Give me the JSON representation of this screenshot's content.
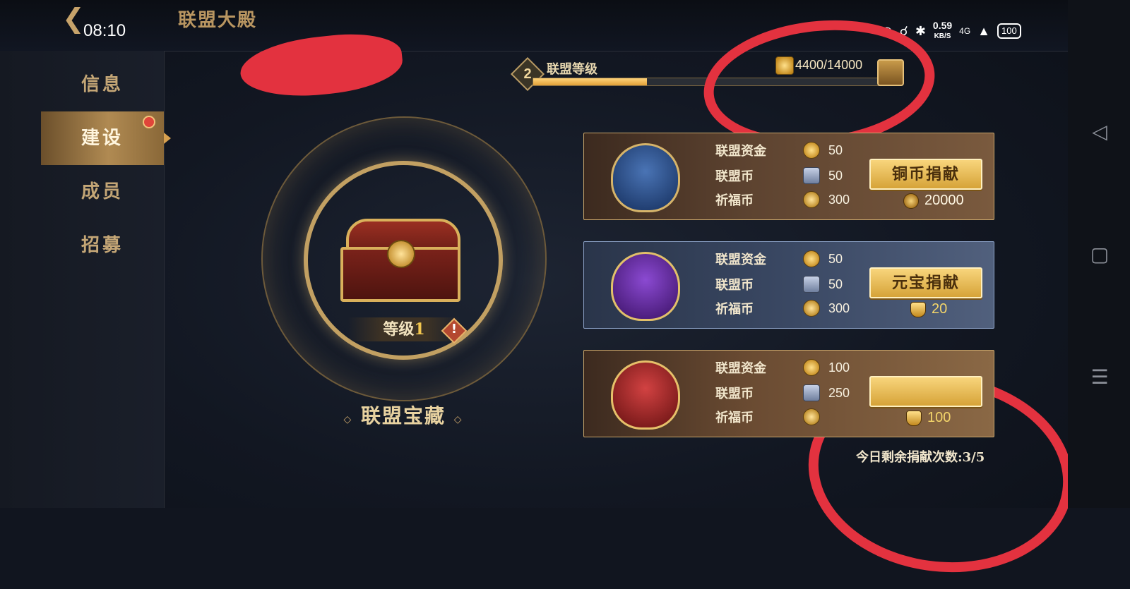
{
  "header": {
    "title": "联盟大殿",
    "time": "08:10",
    "net_speed_value": "0.59",
    "net_speed_unit": "KB/S",
    "network": "4G",
    "battery": "100"
  },
  "sidebar": {
    "items": [
      {
        "label": "信息"
      },
      {
        "label": "建设"
      },
      {
        "label": "成员"
      },
      {
        "label": "招募"
      }
    ]
  },
  "alliance_level": {
    "label": "联盟等级",
    "level": "2",
    "progress_text": "4400/14000",
    "progress_fraction": 0.314
  },
  "treasure": {
    "level_label": "等级",
    "level_value": "1",
    "warning": "!",
    "title": "联盟宝藏"
  },
  "donations": [
    {
      "rewards": [
        {
          "label": "联盟资金",
          "value": "50"
        },
        {
          "label": "联盟币",
          "value": "50"
        },
        {
          "label": "祈福币",
          "value": "300"
        }
      ],
      "button": "铜币捐献",
      "cost": "20000"
    },
    {
      "rewards": [
        {
          "label": "联盟资金",
          "value": "50"
        },
        {
          "label": "联盟币",
          "value": "50"
        },
        {
          "label": "祈福币",
          "value": "300"
        }
      ],
      "button": "元宝捐献",
      "cost": "20"
    },
    {
      "rewards": [
        {
          "label": "联盟资金",
          "value": "100"
        },
        {
          "label": "联盟币",
          "value": "250"
        },
        {
          "label": "祈福币",
          "value": ""
        }
      ],
      "button": "",
      "cost": "100"
    }
  ],
  "remaining_text": "今日剩余捐献次数:3/5",
  "colors": {
    "accent_gold": "#d9b05b",
    "redaction": "#e3323f",
    "progress_fill": "#ffd47a"
  }
}
